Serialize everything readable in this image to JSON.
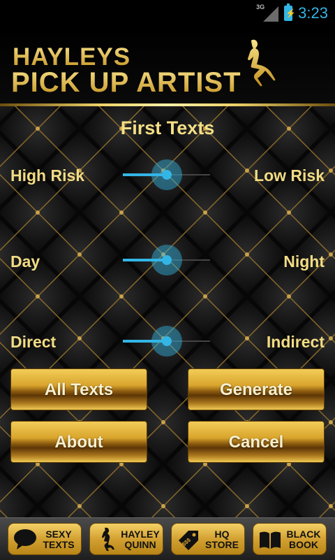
{
  "status_bar": {
    "network": "3G",
    "time": "3:23"
  },
  "header": {
    "logo_line1": "HAYLEYS",
    "logo_line2": "PICK UP ARTIST"
  },
  "screen_title": "First Texts",
  "sliders": [
    {
      "left_label": "High Risk",
      "right_label": "Low Risk",
      "value": 0.5
    },
    {
      "left_label": "Day",
      "right_label": "Night",
      "value": 0.5
    },
    {
      "left_label": "Direct",
      "right_label": "Indirect",
      "value": 0.5
    }
  ],
  "buttons": {
    "all_texts": "All Texts",
    "generate": "Generate",
    "about": "About",
    "cancel": "Cancel"
  },
  "bottom_tabs": [
    {
      "line1": "SEXY",
      "line2": "TEXTS",
      "icon": "speech-bubble-icon"
    },
    {
      "line1": "HAYLEY",
      "line2": "QUINN",
      "icon": "silhouette-icon"
    },
    {
      "line1": "HQ",
      "line2": "STORE",
      "icon": "price-tag-icon"
    },
    {
      "line1": "BLACK",
      "line2": "BOOK",
      "icon": "book-icon"
    }
  ],
  "colors": {
    "accent": "#33b5e5",
    "gold": "#e8c24a",
    "label_text": "#f2dc84"
  }
}
